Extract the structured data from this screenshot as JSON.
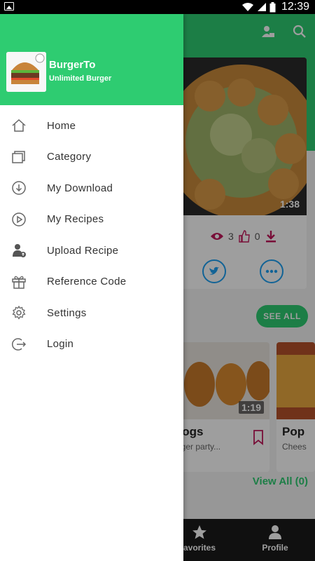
{
  "status_bar": {
    "time": "12:39"
  },
  "drawer": {
    "app_name": "BurgerTo",
    "tagline": "Unlimited Burger",
    "menu": [
      {
        "label": "Home",
        "icon": "home-icon"
      },
      {
        "label": "Category",
        "icon": "category-icon"
      },
      {
        "label": "My Download",
        "icon": "download-icon"
      },
      {
        "label": "My Recipes",
        "icon": "play-icon"
      },
      {
        "label": "Upload Recipe",
        "icon": "upload-user-icon"
      },
      {
        "label": "Reference Code",
        "icon": "gift-icon"
      },
      {
        "label": "Settings",
        "icon": "gear-icon"
      },
      {
        "label": "Login",
        "icon": "login-icon"
      }
    ]
  },
  "background": {
    "featured": {
      "duration": "1:38",
      "views": "3",
      "likes": "0"
    },
    "see_all": "SEE ALL",
    "cards": [
      {
        "title": "Dogs",
        "subtitle": "urger party...",
        "duration": "1:19"
      },
      {
        "title": "Pop",
        "subtitle": "Chees"
      }
    ],
    "view_all": "View All (0)",
    "nav": [
      {
        "label": "avorites"
      },
      {
        "label": "Profile"
      }
    ]
  },
  "colors": {
    "accent": "#2ecc71",
    "nav_bg": "#1a1a1a",
    "text": "#333333",
    "scrim": "rgba(0,0,0,0.38)"
  }
}
